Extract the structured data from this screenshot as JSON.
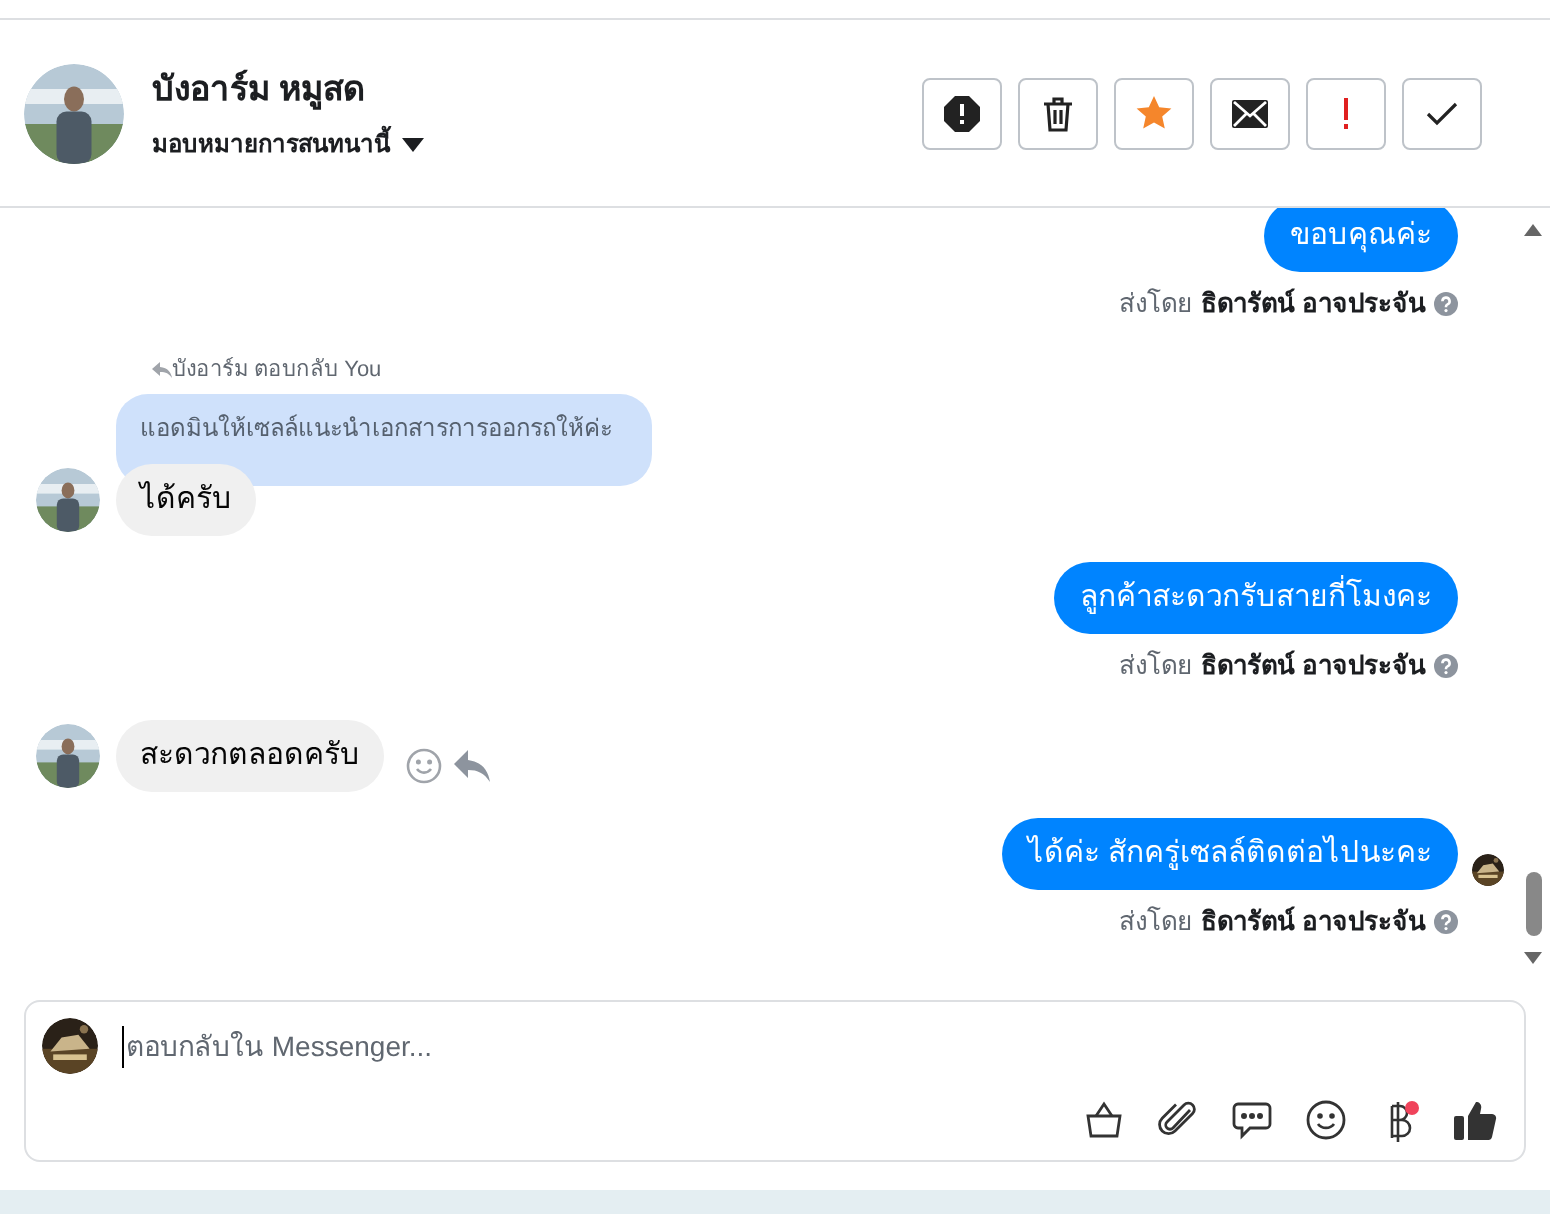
{
  "contact": {
    "name": "บังอาร์ม หมูสด",
    "assign_label": "มอบหมายการสนทนานี้"
  },
  "toolbar": {
    "starred": true
  },
  "messages": [
    {
      "kind": "outgoing",
      "text": "ขอบคุณค่ะ",
      "sent_by_label": "ส่งโดย",
      "sender": "ธิดารัตน์ อาจประจัน",
      "seen": false
    },
    {
      "kind": "incoming",
      "reply_context": "บังอาร์ม ตอบกลับ You",
      "quoted": "แอดมินให้เซลล์แนะนำเอกสารการออกรถให้ค่ะ",
      "text": "ได้ครับ",
      "show_actions": false
    },
    {
      "kind": "outgoing",
      "text": "ลูกค้าสะดวกรับสายกี่โมงคะ",
      "sent_by_label": "ส่งโดย",
      "sender": "ธิดารัตน์ อาจประจัน",
      "seen": false
    },
    {
      "kind": "incoming",
      "text": "สะดวกตลอดครับ",
      "show_actions": true
    },
    {
      "kind": "outgoing",
      "text": "ได้ค่ะ สักครู่เซลล์ติดต่อไปนะคะ",
      "sent_by_label": "ส่งโดย",
      "sender": "ธิดารัตน์ อาจประจัน",
      "seen": true
    }
  ],
  "composer": {
    "placeholder": "ตอบกลับใน Messenger...",
    "payment_badge": true
  }
}
